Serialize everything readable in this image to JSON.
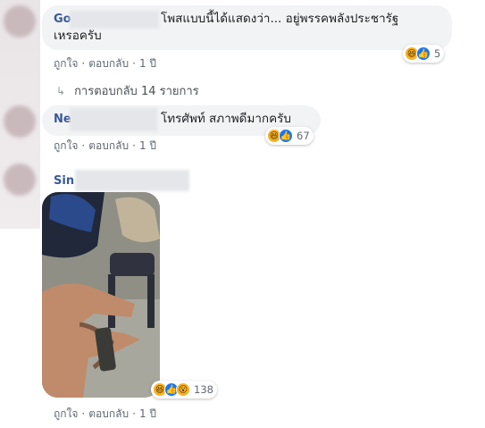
{
  "comments": [
    {
      "author": "Go",
      "text_line1": "โพสแบบนี้ได้แสดงว่า... อยู่พรรคพลังประชารัฐ",
      "text_line2": "เหรอครับ",
      "reaction_count": "5",
      "actions": {
        "like": "ถูกใจ",
        "reply": "ตอบกลับ",
        "time": "1 ปี",
        "dot": "·"
      }
    },
    {
      "author": "Ne",
      "text_line1": "โทรศัพท์ สภาพดีมากครับ",
      "reaction_count": "67",
      "actions": {
        "like": "ถูกใจ",
        "reply": "ตอบกลับ",
        "time": "1 ปี",
        "dot": "·"
      }
    },
    {
      "author": "Sin",
      "reaction_count": "138",
      "actions": {
        "like": "ถูกใจ",
        "reply": "ตอบกลับ",
        "time": "1 ปี",
        "dot": "·"
      }
    }
  ],
  "replies_link": "การตอบกลับ 14 รายการ",
  "icons": {
    "reply_arrow": "reply-arrow-icon",
    "haha": "haha-reaction-icon",
    "like": "like-reaction-icon",
    "wow": "wow-reaction-icon"
  },
  "colors": {
    "author": "#385898",
    "bubble": "#f2f3f5",
    "meta": "#606770",
    "like_blue": "#1877f2",
    "haha_yellow": "#f7b125"
  }
}
